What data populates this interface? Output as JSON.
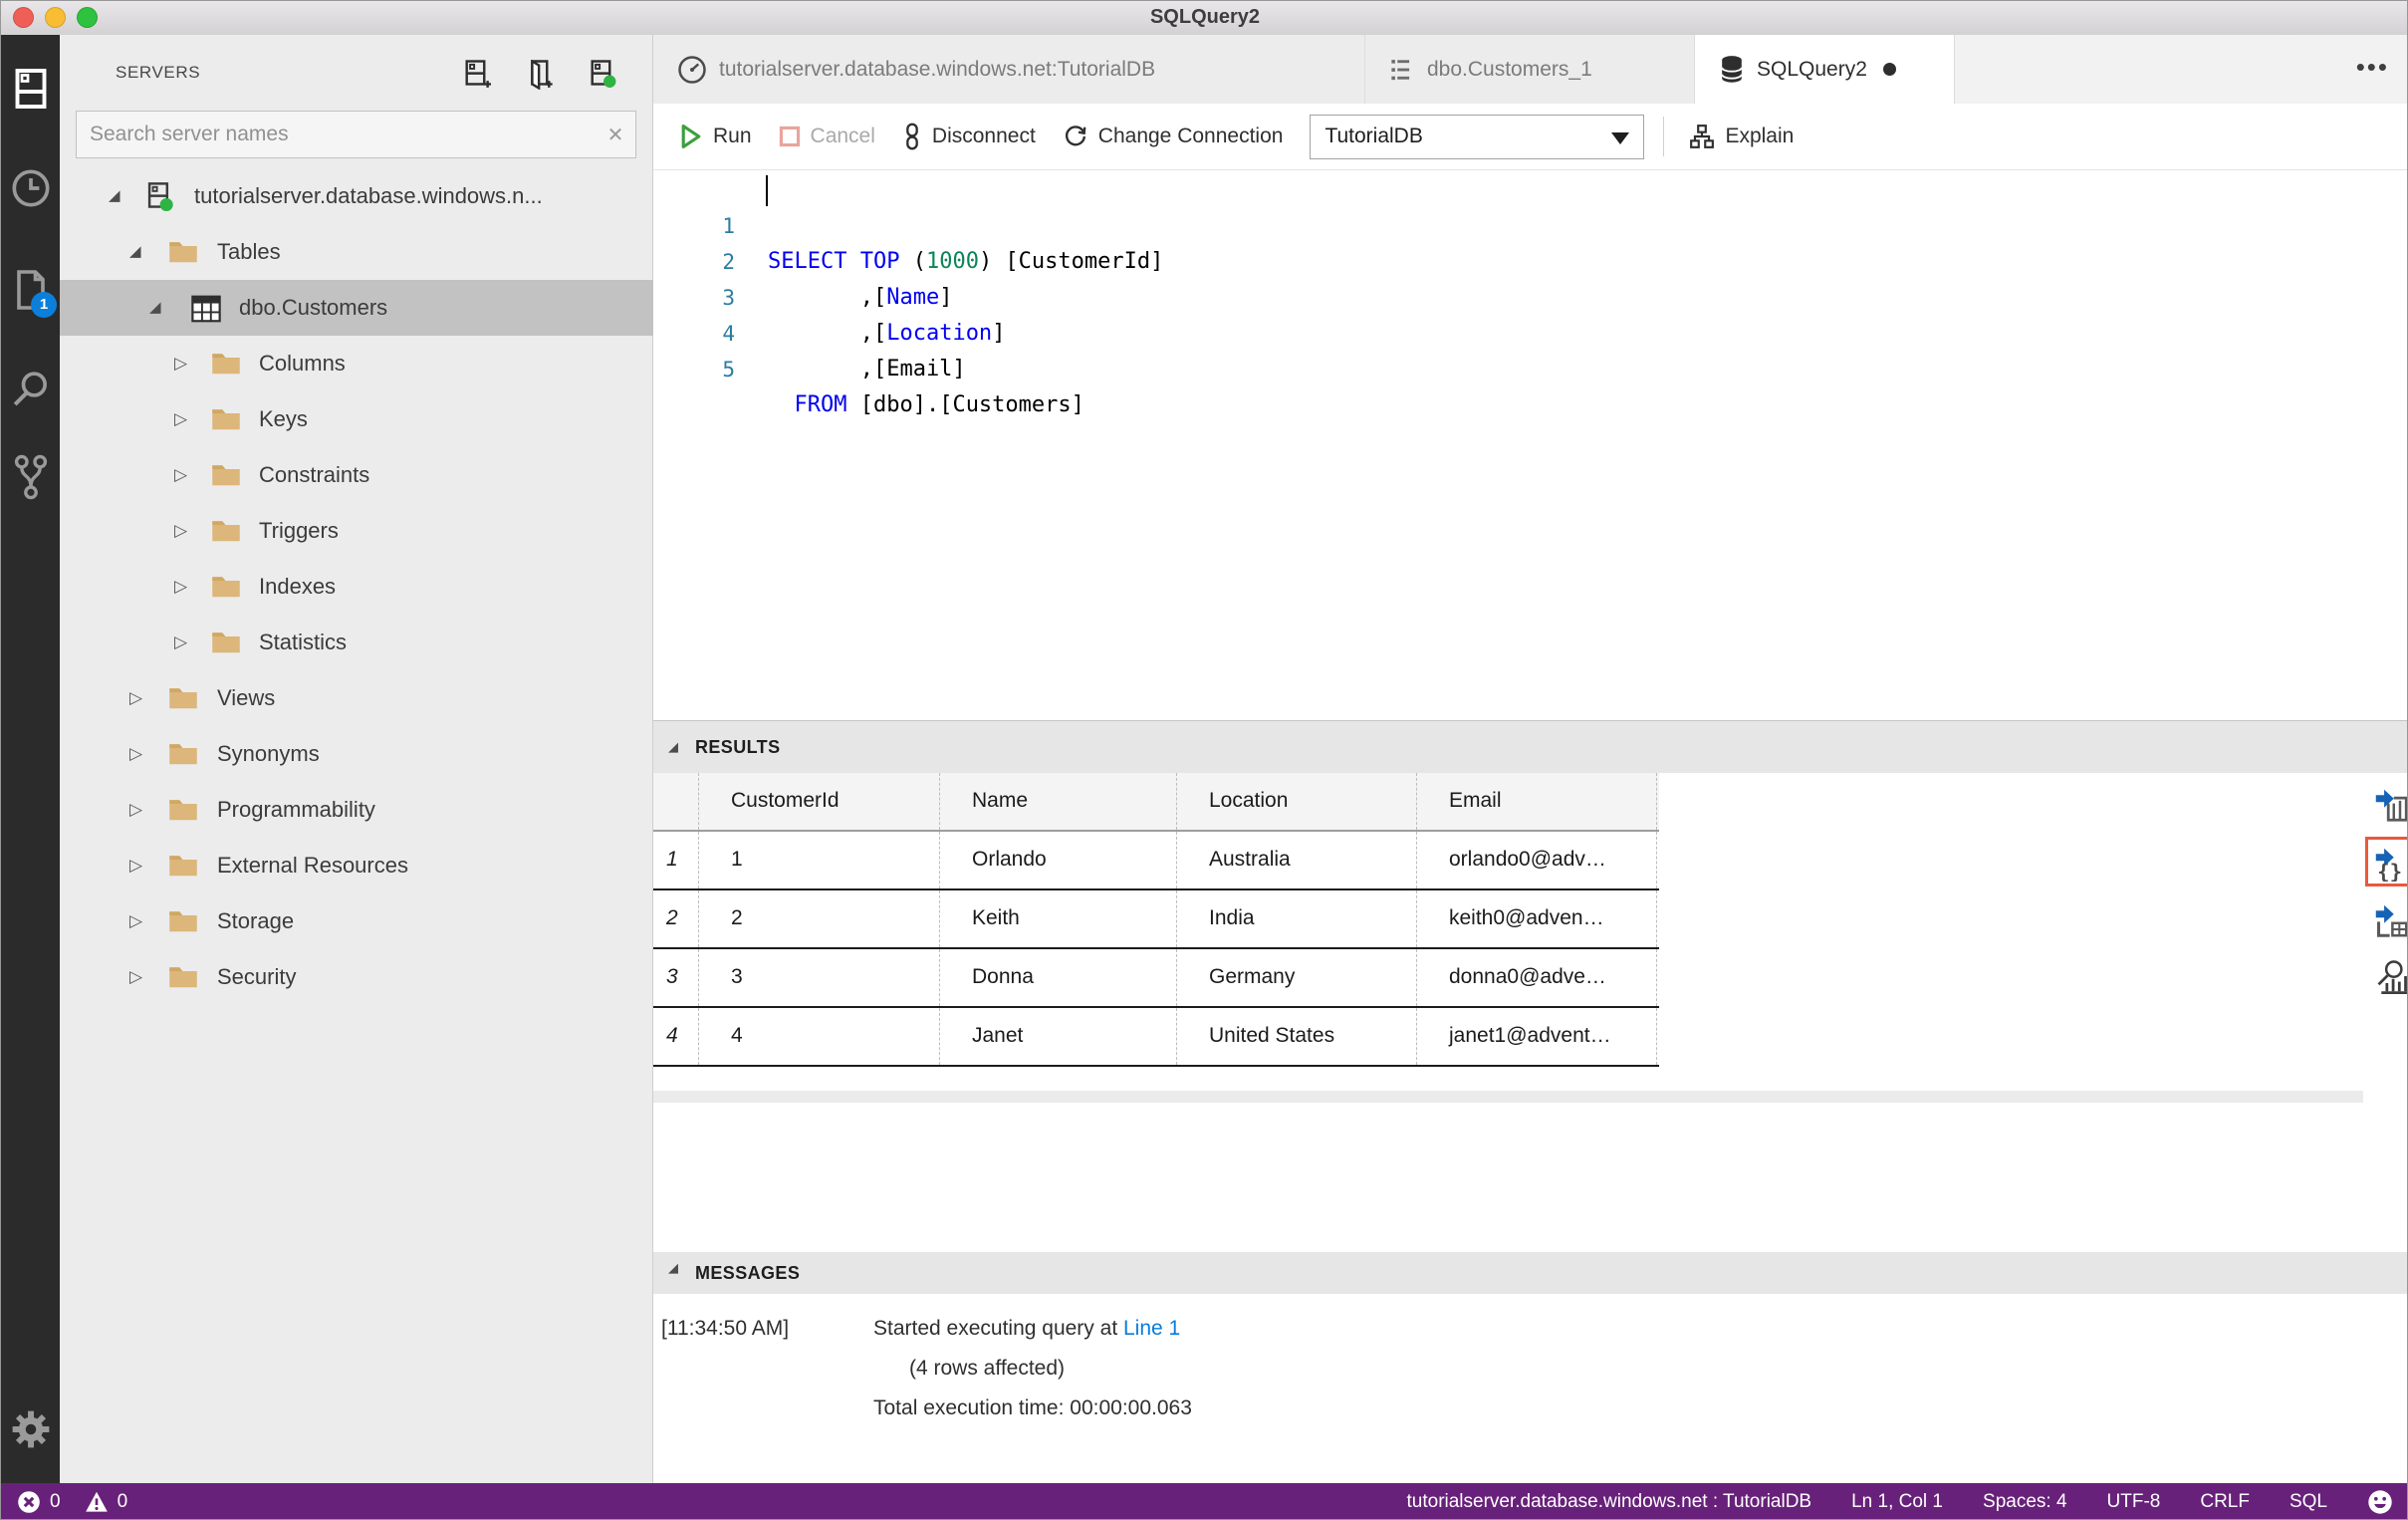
{
  "window": {
    "title": "SQLQuery2"
  },
  "activity_bar": {
    "document_badge": "1"
  },
  "sidebar": {
    "header": "SERVERS",
    "search_placeholder": "Search server names",
    "tree": [
      {
        "label": "tutorialserver.database.windows.n...",
        "level": 0,
        "expanded": true,
        "icon": "server"
      },
      {
        "label": "Tables",
        "level": 1,
        "expanded": true,
        "icon": "folder"
      },
      {
        "label": "dbo.Customers",
        "level": 2,
        "expanded": true,
        "icon": "table",
        "selected": true
      },
      {
        "label": "Columns",
        "level": 3,
        "expanded": false,
        "icon": "folder"
      },
      {
        "label": "Keys",
        "level": 3,
        "expanded": false,
        "icon": "folder"
      },
      {
        "label": "Constraints",
        "level": 3,
        "expanded": false,
        "icon": "folder"
      },
      {
        "label": "Triggers",
        "level": 3,
        "expanded": false,
        "icon": "folder"
      },
      {
        "label": "Indexes",
        "level": 3,
        "expanded": false,
        "icon": "folder"
      },
      {
        "label": "Statistics",
        "level": 3,
        "expanded": false,
        "icon": "folder"
      },
      {
        "label": "Views",
        "level": 1,
        "expanded": false,
        "icon": "folder"
      },
      {
        "label": "Synonyms",
        "level": 1,
        "expanded": false,
        "icon": "folder"
      },
      {
        "label": "Programmability",
        "level": 1,
        "expanded": false,
        "icon": "folder"
      },
      {
        "label": "External Resources",
        "level": 1,
        "expanded": false,
        "icon": "folder"
      },
      {
        "label": "Storage",
        "level": 1,
        "expanded": false,
        "icon": "folder"
      },
      {
        "label": "Security",
        "level": 1,
        "expanded": false,
        "icon": "folder"
      }
    ]
  },
  "tabs": [
    {
      "label": "tutorialserver.database.windows.net:TutorialDB",
      "icon": "dashboard-gauge",
      "active": false
    },
    {
      "label": "dbo.Customers_1",
      "icon": "edit-data-list",
      "active": false
    },
    {
      "label": "SQLQuery2",
      "icon": "database",
      "active": true,
      "dirty": true
    }
  ],
  "more_actions": "•••",
  "toolbar": {
    "run": "Run",
    "cancel": "Cancel",
    "disconnect": "Disconnect",
    "change_connection": "Change Connection",
    "database_selected": "TutorialDB",
    "explain": "Explain"
  },
  "editor": {
    "line_numbers": [
      "1",
      "2",
      "3",
      "4",
      "5"
    ],
    "lines": [
      {
        "t0": "SELECT TOP",
        "t1": " (",
        "t2": "1000",
        "t3": ") [CustomerId]"
      },
      {
        "t0": "       ,[",
        "t1": "Name",
        "t2": "]"
      },
      {
        "t0": "       ,[",
        "t1": "Location",
        "t2": "]"
      },
      {
        "t0": "       ,[Email]"
      },
      {
        "t0": "  ",
        "t1": "FROM",
        "t2": " [dbo].[Customers]"
      }
    ]
  },
  "results": {
    "panel_title": "RESULTS",
    "columns": [
      "CustomerId",
      "Name",
      "Location",
      "Email"
    ],
    "rows": [
      [
        "1",
        "1",
        "Orlando",
        "Australia",
        "orlando0@adv…"
      ],
      [
        "2",
        "2",
        "Keith",
        "India",
        "keith0@adven…"
      ],
      [
        "3",
        "3",
        "Donna",
        "Germany",
        "donna0@adve…"
      ],
      [
        "4",
        "4",
        "Janet",
        "United States",
        "janet1@advent…"
      ]
    ],
    "actions": [
      "save-as-csv",
      "save-as-json",
      "save-as-excel",
      "view-as-chart"
    ],
    "focused_action": "save-as-json"
  },
  "messages": {
    "panel_title": "MESSAGES",
    "timestamp": "[11:34:50 AM]",
    "line1_prefix": "Started executing query at ",
    "line1_link": "Line 1",
    "line2": "(4 rows affected)",
    "line3": "Total execution time: 00:00:00.063"
  },
  "status_bar": {
    "errors": "0",
    "warnings": "0",
    "connection": "tutorialserver.database.windows.net : TutorialDB",
    "cursor_position": "Ln 1, Col 1",
    "indentation": "Spaces: 4",
    "encoding": "UTF-8",
    "eol": "CRLF",
    "language": "SQL"
  },
  "colors": {
    "status_bar": "#68217A",
    "badge_blue": "#0C7FDA",
    "keyword_blue": "#0000F0",
    "number_green": "#098658",
    "line_number_teal": "#2A7DA0",
    "run_green": "#3BA03B",
    "cancel_salmon": "#E8A59C",
    "folder_tan": "#DCB67A",
    "focus_orange": "#E8593C",
    "link_blue": "#0B7BD8"
  }
}
